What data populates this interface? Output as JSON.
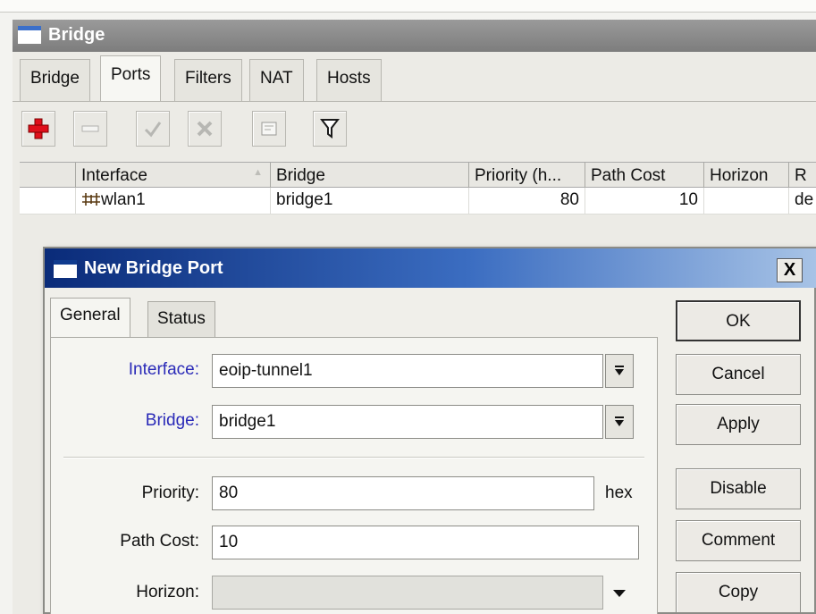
{
  "window": {
    "title": "Bridge"
  },
  "tabs": [
    {
      "label": "Bridge"
    },
    {
      "label": "Ports",
      "active": true
    },
    {
      "label": "Filters"
    },
    {
      "label": "NAT"
    },
    {
      "label": "Hosts"
    }
  ],
  "toolbar": {
    "add_icon": "plus-icon",
    "remove_icon": "minus-icon",
    "enable_icon": "check-icon",
    "disable_icon": "cross-icon",
    "comment_icon": "comment-icon",
    "filter_icon": "filter-icon",
    "add_color": "#e0101b"
  },
  "table": {
    "columns": [
      "",
      "Interface",
      "Bridge",
      "Priority (h...",
      "Path Cost",
      "Horizon",
      "R"
    ],
    "sort_indicator": "▲",
    "rows": [
      {
        "interface": "wlan1",
        "bridge": "bridge1",
        "priority": "80",
        "path_cost": "10",
        "horizon": "",
        "r": "de"
      }
    ]
  },
  "dialog": {
    "title": "New Bridge Port",
    "close_label": "X",
    "tabs": [
      {
        "label": "General",
        "active": true
      },
      {
        "label": "Status"
      }
    ],
    "fields": {
      "interface_label": "Interface:",
      "interface_value": "eoip-tunnel1",
      "bridge_label": "Bridge:",
      "bridge_value": "bridge1",
      "priority_label": "Priority:",
      "priority_value": "80",
      "priority_suffix": "hex",
      "path_cost_label": "Path Cost:",
      "path_cost_value": "10",
      "horizon_label": "Horizon:",
      "horizon_value": ""
    },
    "label_link_color": "#2a2ab8",
    "buttons": [
      "OK",
      "Cancel",
      "Apply",
      "Disable",
      "Comment",
      "Copy"
    ]
  }
}
